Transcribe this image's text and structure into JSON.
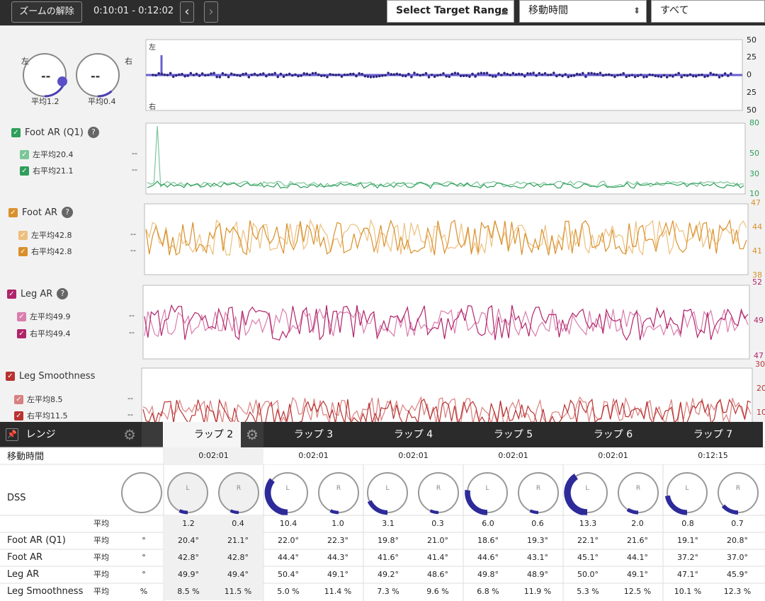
{
  "toolbar": {
    "zoom_reset": "ズームの解除",
    "time_range": "0:10:01 - 0:12:02",
    "prev": "‹",
    "next": "›",
    "target_range": "Select Target Range",
    "metric_select": "移動時間",
    "filter_select": "すべて"
  },
  "balance": {
    "left_label": "左",
    "right_label": "右",
    "left_value": "--",
    "right_value": "--",
    "left_avg": "平均1.2",
    "right_avg": "平均0.4",
    "plot_top_label": "左",
    "plot_bottom_label": "右",
    "axis": [
      "50",
      "25",
      "0",
      "25",
      "50"
    ]
  },
  "sections": [
    {
      "title": "Foot AR (Q1)",
      "color": "#2e9e5a",
      "left_avg": "左平均20.4",
      "right_avg": "右平均21.1",
      "left_val": "--",
      "right_val": "--",
      "axis": [
        "80",
        "50",
        "30",
        "10"
      ]
    },
    {
      "title": "Foot AR",
      "color": "#d9902b",
      "left_avg": "左平均42.8",
      "right_avg": "右平均42.8",
      "left_val": "--",
      "right_val": "--",
      "axis": [
        "47",
        "44",
        "41",
        "38"
      ]
    },
    {
      "title": "Leg AR",
      "color": "#b0246a",
      "left_avg": "左平均49.9",
      "right_avg": "右平均49.4",
      "left_val": "--",
      "right_val": "--",
      "axis": [
        "52",
        "49",
        "47"
      ]
    },
    {
      "title": "Leg Smoothness",
      "color": "#b83232",
      "left_avg": "左平均8.5",
      "right_avg": "右平均11.5",
      "left_val": "--",
      "right_val": "--",
      "axis": [
        "30",
        "20",
        "10"
      ]
    }
  ],
  "table": {
    "range_label": "レンジ",
    "header_row_label": "移動時間",
    "dss_label": "DSS",
    "avg_label": "平均",
    "rows": [
      "Foot AR (Q1)",
      "Foot AR",
      "Leg AR",
      "Leg Smoothness"
    ],
    "partial_col": [
      "°",
      "°",
      "°",
      "%"
    ],
    "gauge_L": "L",
    "gauge_R": "R",
    "laps": [
      {
        "name": "ラップ 2",
        "time": "0:02:01",
        "dss": [
          "1.2",
          "0.4"
        ],
        "foot_ar_q1": [
          "20.4°",
          "21.1°"
        ],
        "foot_ar": [
          "42.8°",
          "42.8°"
        ],
        "leg_ar": [
          "49.9°",
          "49.4°"
        ],
        "leg_smooth": [
          "8.5 %",
          "11.5 %"
        ],
        "fillL": 0.15,
        "fillR": 0.05
      },
      {
        "name": "ラップ 3",
        "time": "0:02:01",
        "dss": [
          "10.4",
          "1.0"
        ],
        "foot_ar_q1": [
          "22.0°",
          "22.3°"
        ],
        "foot_ar": [
          "44.4°",
          "44.3°"
        ],
        "leg_ar": [
          "50.4°",
          "49.1°"
        ],
        "leg_smooth": [
          "5.0 %",
          "11.4 %"
        ],
        "fillL": 0.8,
        "fillR": 0.1
      },
      {
        "name": "ラップ 4",
        "time": "0:02:01",
        "dss": [
          "3.1",
          "0.3"
        ],
        "foot_ar_q1": [
          "19.8°",
          "21.0°"
        ],
        "foot_ar": [
          "41.6°",
          "41.4°"
        ],
        "leg_ar": [
          "49.2°",
          "48.6°"
        ],
        "leg_smooth": [
          "7.3 %",
          "9.6 %"
        ],
        "fillL": 0.4,
        "fillR": 0.05
      },
      {
        "name": "ラップ 5",
        "time": "0:02:01",
        "dss": [
          "6.0",
          "0.6"
        ],
        "foot_ar_q1": [
          "18.6°",
          "19.3°"
        ],
        "foot_ar": [
          "44.6°",
          "43.1°"
        ],
        "leg_ar": [
          "49.8°",
          "48.9°"
        ],
        "leg_smooth": [
          "6.8 %",
          "11.9 %"
        ],
        "fillL": 0.6,
        "fillR": 0.08
      },
      {
        "name": "ラップ 6",
        "time": "0:02:01",
        "dss": [
          "13.3",
          "2.0"
        ],
        "foot_ar_q1": [
          "22.1°",
          "21.6°"
        ],
        "foot_ar": [
          "45.1°",
          "44.1°"
        ],
        "leg_ar": [
          "50.0°",
          "49.1°"
        ],
        "leg_smooth": [
          "5.3 %",
          "12.5 %"
        ],
        "fillL": 0.9,
        "fillR": 0.2
      },
      {
        "name": "ラップ 7",
        "time": "0:12:15",
        "dss": [
          "0.8",
          "0.7"
        ],
        "foot_ar_q1": [
          "19.1°",
          "20.8°"
        ],
        "foot_ar": [
          "37.2°",
          "37.0°"
        ],
        "leg_ar": [
          "47.1°",
          "45.9°"
        ],
        "leg_smooth": [
          "10.1 %",
          "12.3 %"
        ],
        "fillL": 0.5,
        "fillR": 0.3
      }
    ]
  },
  "colors": {
    "balance": "#4a3fb0",
    "foot_ar_q1": "#2e9e5a",
    "foot_ar": "#d9902b",
    "leg_ar": "#b0246a",
    "leg_smooth": "#b83232",
    "gauge_fill": "#2d2a9a"
  }
}
